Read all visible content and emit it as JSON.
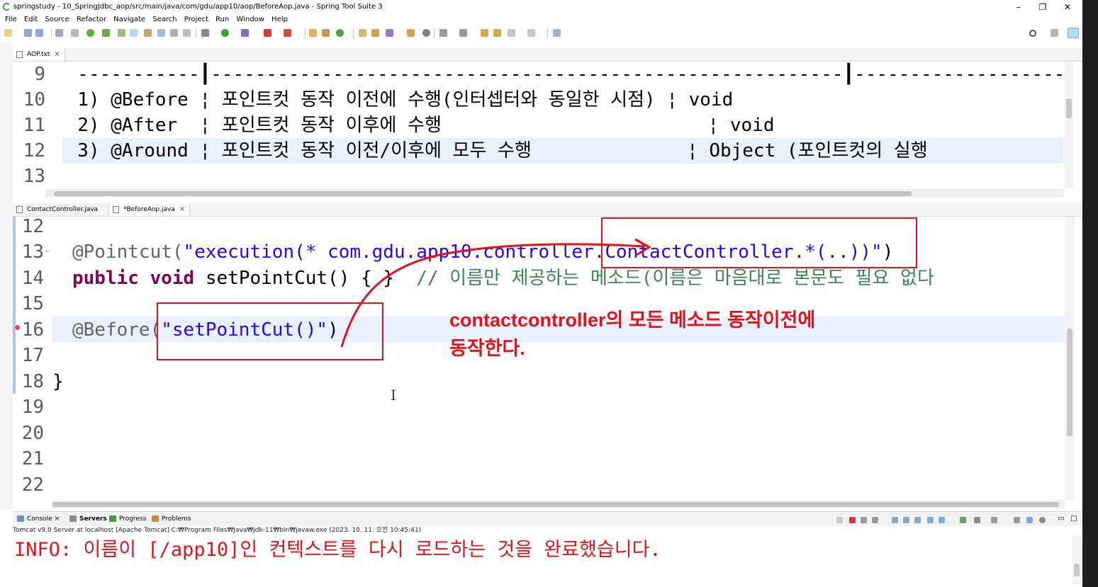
{
  "window": {
    "title": "springstudy - 10_SpringJdbc_aop/src/main/java/com/gdu/app10/aop/BeforeAop.java - Spring Tool Suite 3",
    "minimize": "–",
    "maximize": "❐",
    "close": "✕"
  },
  "menu": [
    "File",
    "Edit",
    "Source",
    "Refactor",
    "Navigate",
    "Search",
    "Project",
    "Run",
    "Window",
    "Help"
  ],
  "editor_top": {
    "tab_label": "AOP.txt",
    "lines": [
      {
        "num": "9",
        "text": "  -----------┃---------------------------------------------------------┃-------------------------"
      },
      {
        "num": "10",
        "text": "  1) @Before ¦ 포인트컷 동작 이전에 수행(인터셉터와 동일한 시점) ¦ void"
      },
      {
        "num": "11",
        "text": "  2) @After  ¦ 포인트컷 동작 이후에 수행                        ¦ void"
      },
      {
        "num": "12",
        "text": "  3) @Around ¦ 포인트컷 동작 이전/이후에 모두 수행              ¦ Object (포인트컷의 실행"
      },
      {
        "num": "13",
        "text": ""
      }
    ]
  },
  "editor_bottom": {
    "tabs": [
      {
        "label": "ContactController.java"
      },
      {
        "label": "*BeforeAop.java"
      }
    ],
    "line_numbers": [
      "12",
      "13",
      "14",
      "15",
      "16",
      "17",
      "18",
      "19",
      "20",
      "21",
      "22"
    ],
    "code": {
      "l13_ann": "@Pointcut(",
      "l13_str": "\"execution(* com.gdu.app10.controller.ContactController.*(..))\"",
      "l13_end": ")",
      "l14_kw1": "public",
      "l14_kw2": "void",
      "l14_rest": " setPointCut() { }  ",
      "l14_cmt": "// 이름만 제공하는 메소드(이름은 마음대로 본문도 필요 없다",
      "l16_ann": "@Before(",
      "l16_str": "\"setPointCut()\"",
      "l16_end": ")",
      "l18": "}"
    }
  },
  "annotation": {
    "line1": "contactcontroller의 모든 메소드 동작이전에",
    "line2": "동작한다."
  },
  "console": {
    "tabs": [
      {
        "label": "Console",
        "bold": false
      },
      {
        "label": "Servers",
        "bold": true
      },
      {
        "label": "Progress",
        "bold": false
      },
      {
        "label": "Problems",
        "bold": false
      }
    ],
    "description": "Tomcat v9.0 Server at localhost [Apache Tomcat] C:₩Program Files₩Java₩jdk-11₩bin₩javaw.exe  (2023. 10. 11. 오전 10:45:41)",
    "output": "INFO: 이름이 [/app10]인 컨텍스트를 다시 로드하는 것을 완료했습니다."
  },
  "colors": {
    "annotation_red": "#e0131b",
    "keyword": "#7f0055",
    "string": "#2a00ff",
    "comment": "#3f7f5f",
    "current_line": "#e8f2fe"
  }
}
